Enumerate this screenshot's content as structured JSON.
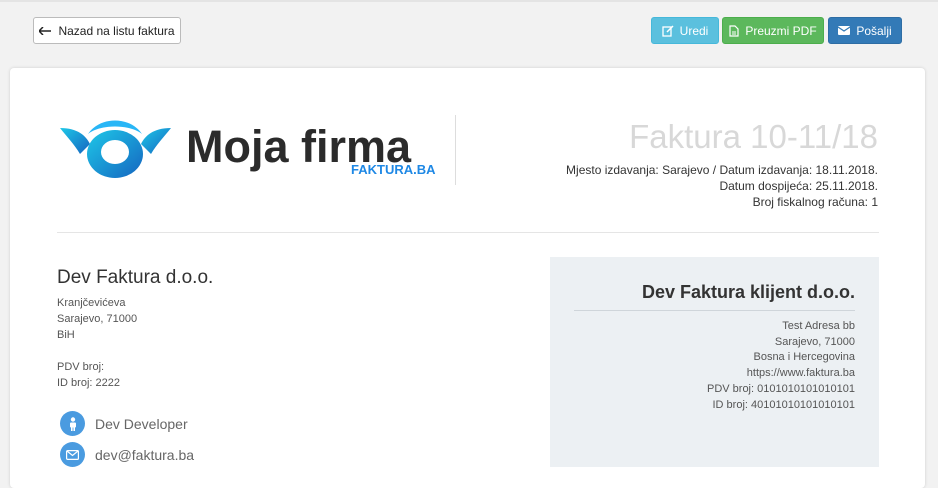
{
  "toolbar": {
    "back_label": "Nazad na listu faktura",
    "edit_label": "Uredi",
    "pdf_label": "Preuzmi PDF",
    "send_label": "Pošalji"
  },
  "logo": {
    "name": "Moja firma",
    "sub": "FAKTURA.BA"
  },
  "invoice": {
    "title": "Faktura 10-11/18",
    "place_date": "Mjesto izdavanja: Sarajevo / Datum izdavanja: 18.11.2018.",
    "due_date": "Datum dospijeća: 25.11.2018.",
    "fiscal": "Broj fiskalnog računa: 1"
  },
  "seller": {
    "name": "Dev Faktura d.o.o.",
    "street": "Kranjčevićeva",
    "city": "Sarajevo, 71000",
    "country": "BiH",
    "pdv": "PDV broj:",
    "id": "ID broj: 2222",
    "contact_person": "Dev Developer",
    "email": "dev@faktura.ba"
  },
  "client": {
    "name": "Dev Faktura klijent d.o.o.",
    "address": "Test Adresa bb",
    "city": "Sarajevo, 71000",
    "country": "Bosna i Hercegovina",
    "web": "https://www.faktura.ba",
    "pdv": "PDV broj: 0101010101010101",
    "id": "ID broj: 40101010101010101"
  },
  "icons": [
    "arrow-left-icon",
    "edit-icon",
    "pdf-file-icon",
    "envelope-icon",
    "person-icon",
    "envelope-icon"
  ],
  "colors": {
    "edit": "#5bc0de",
    "pdf": "#5cb85c",
    "send": "#337ab7",
    "logo_blue": "#1e88e5",
    "client_bg": "#ecf0f3"
  }
}
